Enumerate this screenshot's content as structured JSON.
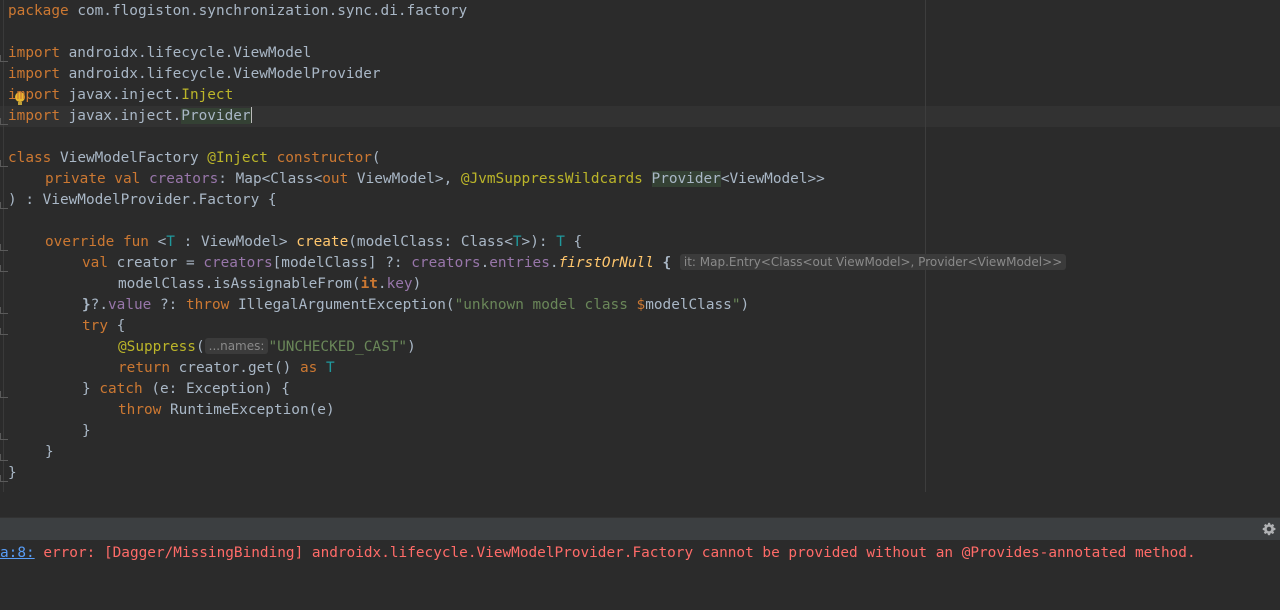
{
  "editor": {
    "lines": {
      "package_kw": "package",
      "package_name": " com.flogiston.synchronization.sync.di.factory",
      "import_kw": "import",
      "import1": " androidx.lifecycle.ViewModel",
      "import2": " androidx.lifecycle.ViewModelProvider",
      "import3_pre": " javax.inject.",
      "import3_name": "Inject",
      "import4_pre": " javax.inject.",
      "import4_name": "Provider",
      "class_kw": "class",
      "class_name": " ViewModelFactory ",
      "inject_ann": "@Inject",
      "constructor_kw": " constructor",
      "paren_open": "(",
      "private_val": "private val",
      "creators": "creators",
      "map_pre": ": Map<Class<",
      "out_kw": "out",
      "map_mid": " ViewModel>, ",
      "jvm_ann": "@JvmSuppressWildcards",
      "space": " ",
      "provider": "Provider",
      "map_end": "<ViewModel>>",
      "factory_line": ") : ViewModelProvider.Factory {",
      "override_fun": "override fun",
      "generic_open": " <",
      "T": "T",
      "generic_mid": " : ViewModel> ",
      "create": "create",
      "create_params": "(modelClass: Class<",
      "create_params_end": ">): ",
      "brace_open": " {",
      "val_kw": "val",
      "creator_assign": " creator = ",
      "creators_index": "[modelClass] ?: ",
      "entries": "entries",
      "dot": ".",
      "firstOrNull": "firstOrNull",
      "brace_bold": " {",
      "hint_it": "it: Map.Entry<Class<out ViewModel>, Provider<ViewModel>>",
      "assignable_pre": "modelClass.isAssignableFrom(",
      "it_kw": "it",
      "key": "key",
      "close_paren": ")",
      "close_brace_bold": "}",
      "value_pre": "?.",
      "value": "value",
      "elvis": " ?: ",
      "throw_kw": "throw",
      "iae": " IllegalArgumentException(",
      "iae_str": "\"unknown model class ",
      "dollar": "$",
      "iae_str_var": "modelClass",
      "iae_str_end": "\"",
      "try_kw": "try",
      "suppress_ann": "@Suppress",
      "hint_names": "...names:",
      "unchecked_str": "\"UNCHECKED_CAST\"",
      "return_kw": "return",
      "creator_get": " creator.get() ",
      "as_kw": "as",
      "catch_pre": "} ",
      "catch_kw": "catch",
      "catch_rest": " (e: Exception) {",
      "runtime_exc": " RuntimeException(e)",
      "close": "}"
    }
  },
  "console": {
    "error_link": "a:8:",
    "error_text": " error: [Dagger/MissingBinding] androidx.lifecycle.ViewModelProvider.Factory cannot be provided without an @Provides-annotated method."
  },
  "icons": {
    "gear": "gear-icon",
    "bulb": "lightbulb-icon"
  },
  "colors": {
    "keyword": "#cc7832",
    "annotation": "#bbb529",
    "string": "#6a8759",
    "function": "#ffc66d",
    "type_param": "#20999d",
    "property": "#9876aa",
    "error": "#ff6b68",
    "link": "#589df6"
  }
}
